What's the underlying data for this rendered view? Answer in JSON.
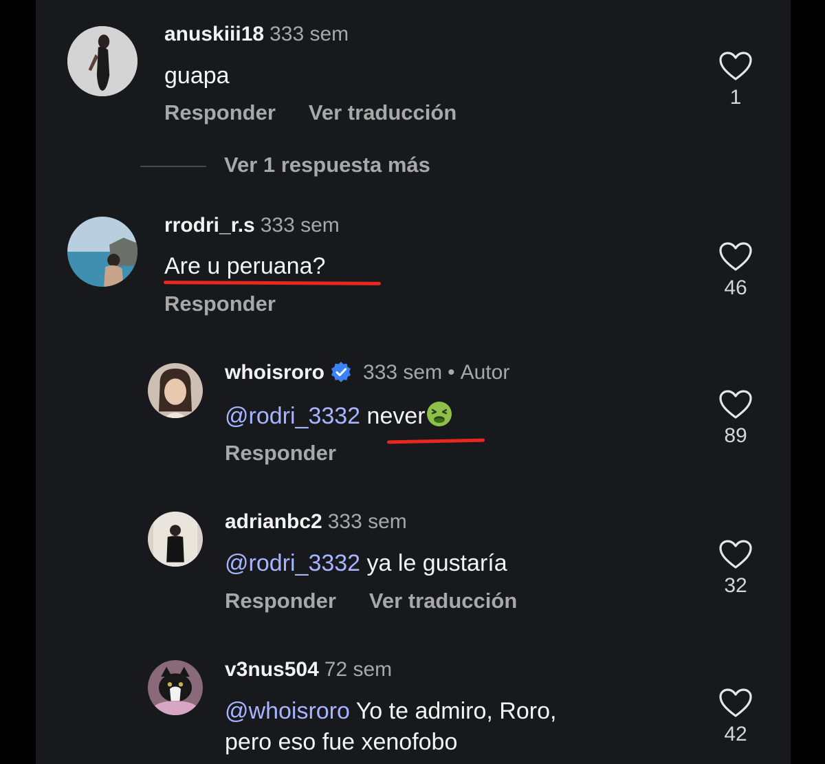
{
  "comments": [
    {
      "username": "anuskiii18",
      "time": "333 sem",
      "text": "guapa",
      "reply": "Responder",
      "translate": "Ver traducción",
      "likes": "1"
    },
    {
      "username": "rrodri_r.s",
      "time": "333 sem",
      "text": "Are u peruana?",
      "reply": "Responder",
      "likes": "46"
    },
    {
      "username": "whoisroro",
      "time": "333 sem",
      "separator": "•",
      "author_badge": "Autor",
      "mention": "@rodri_3332",
      "text": "never",
      "emoji": "nauseated-face-icon",
      "reply": "Responder",
      "likes": "89"
    },
    {
      "username": "adrianbc2",
      "time": "333 sem",
      "mention": "@rodri_3332",
      "text": "ya le gustaría",
      "reply": "Responder",
      "translate": "Ver traducción",
      "likes": "32"
    },
    {
      "username": "v3nus504",
      "time": "72 sem",
      "mention": "@whoisroro",
      "text_line1": "Yo te admiro, Roro,",
      "text_line2": "pero eso fue xenofobo",
      "likes": "42"
    }
  ],
  "more_replies": "Ver 1 respuesta más",
  "colors": {
    "background": "#18191d",
    "mention": "#a7b4ff",
    "verified": "#3b82f6",
    "highlight_underline": "#e8271f"
  }
}
